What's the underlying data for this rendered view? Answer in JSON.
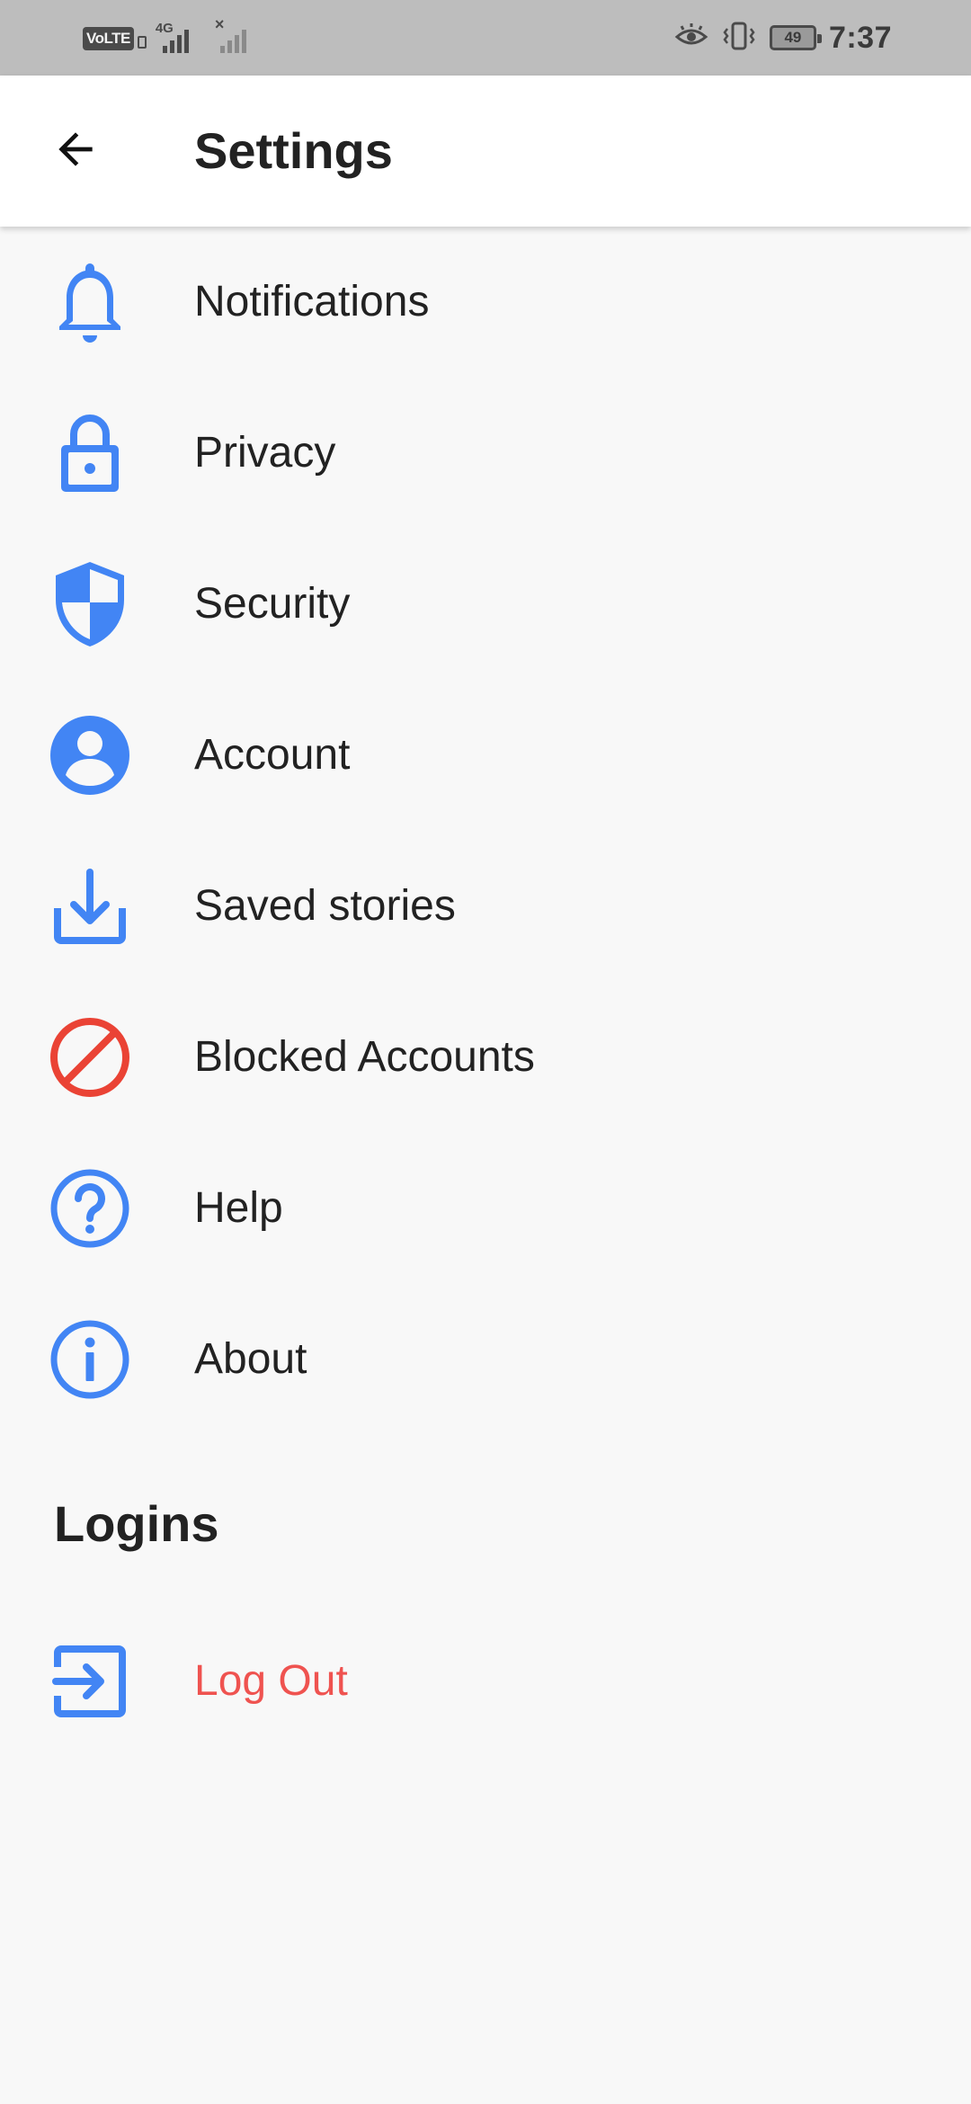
{
  "status_bar": {
    "carrier_badge": "VoLTE",
    "network_type": "4G",
    "secondary_signal": "×",
    "battery_percent": "49",
    "time": "7:37"
  },
  "header": {
    "title": "Settings",
    "back_icon": "arrow-left-icon"
  },
  "menu": {
    "items": [
      {
        "label": "Notifications",
        "icon": "bell-icon",
        "color": "#4285f4"
      },
      {
        "label": "Privacy",
        "icon": "lock-icon",
        "color": "#4285f4"
      },
      {
        "label": "Security",
        "icon": "shield-icon",
        "color": "#4285f4"
      },
      {
        "label": "Account",
        "icon": "account-circle-icon",
        "color": "#4285f4"
      },
      {
        "label": "Saved stories",
        "icon": "download-icon",
        "color": "#4285f4"
      },
      {
        "label": "Blocked Accounts",
        "icon": "block-icon",
        "color": "#ea4335"
      },
      {
        "label": "Help",
        "icon": "help-circle-icon",
        "color": "#4285f4"
      },
      {
        "label": "About",
        "icon": "info-circle-icon",
        "color": "#4285f4"
      }
    ]
  },
  "logins": {
    "heading": "Logins",
    "logout_label": "Log Out",
    "logout_icon": "exit-icon",
    "logout_color": "#ef5350"
  },
  "colors": {
    "accent": "#4285f4",
    "danger": "#ea4335",
    "text": "#222222",
    "background": "#f8f8f8",
    "status_bar": "#bdbdbd"
  }
}
